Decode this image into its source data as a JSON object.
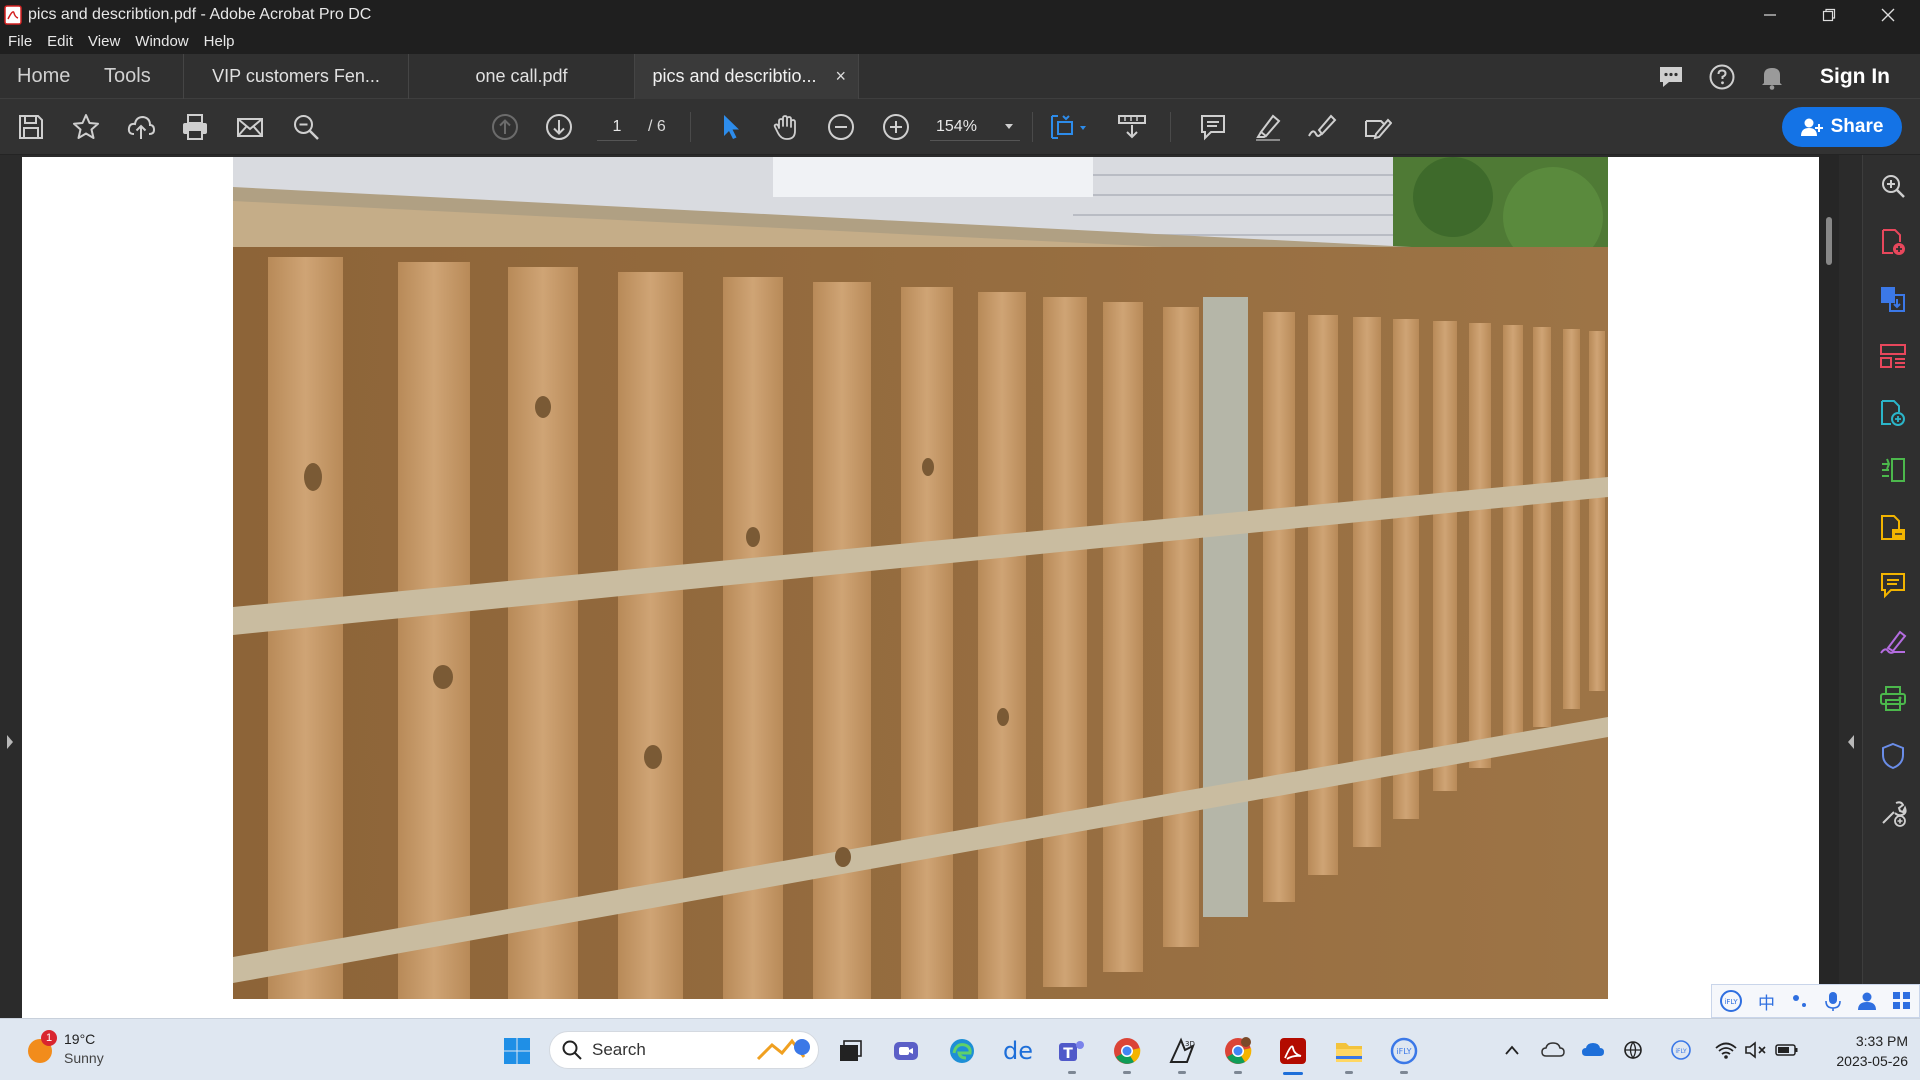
{
  "window": {
    "title": "pics and describtion.pdf - Adobe Acrobat Pro DC"
  },
  "menu": [
    "File",
    "Edit",
    "View",
    "Window",
    "Help"
  ],
  "tabs": {
    "home": "Home",
    "tools": "Tools",
    "docs": [
      {
        "label": "VIP customers  Fen..."
      },
      {
        "label": "one call.pdf"
      },
      {
        "label": "pics and describtio..."
      }
    ],
    "close_glyph": "×",
    "sign_in": "Sign In"
  },
  "toolbar": {
    "page_current": "1",
    "page_total": "/ 6",
    "zoom": "154%",
    "share": "Share"
  },
  "taskbar": {
    "weather_badge": "1",
    "temperature": "19°C",
    "condition": "Sunny",
    "search_placeholder": "Search",
    "time": "3:33 PM",
    "date": "2023-05-26",
    "ime_char": "中"
  },
  "icons": {
    "toolbar": [
      "save-icon",
      "star-icon",
      "upload-icon",
      "print-icon",
      "mail-icon",
      "zoom-search-icon",
      "prev-page-icon",
      "next-page-icon",
      "select-cursor-icon",
      "hand-icon",
      "zoom-out-icon",
      "zoom-in-icon",
      "fit-page-icon",
      "scroll-mode-icon",
      "comment-icon",
      "highlight-icon",
      "sign-icon",
      "fill-sign-icon"
    ],
    "right_panel": [
      "search-zoom-icon",
      "create-pdf-icon",
      "export-pdf-icon",
      "organize-pages-icon",
      "edit-pdf-icon",
      "compare-icon",
      "export-icon",
      "comment-icon",
      "fill-sign-icon",
      "print-production-icon",
      "protect-icon",
      "more-tools-icon"
    ],
    "colors": {
      "accent": "#1473e6",
      "titlebar": "#1f1f1f",
      "toolbar": "#323232",
      "taskbar": "#dfe7f1"
    }
  }
}
